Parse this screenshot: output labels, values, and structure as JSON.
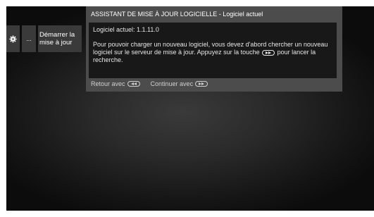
{
  "sidebar": {
    "gear_icon": "gear-icon",
    "dots_label": "...",
    "start_label": "Démarrer la\nmise à jour"
  },
  "dialog": {
    "title": "ASSISTANT DE MISE À JOUR LOGICIELLE - Logiciel actuel",
    "version_line": "Logiciel actuel:  1.1.11.0",
    "description_part1": "Pour pouvoir charger un nouveau logiciel, vous devez d'abord chercher un nouveau logiciel sur le serveur de mise à jour. Appuyez sur la touche",
    "description_icon": "fast-forward-button-icon",
    "description_part2": "pour lancer la recherche.",
    "footer": {
      "back_label": "Retour avec",
      "back_icon": "rewind-button-icon",
      "continue_label": "Continuer avec",
      "continue_icon": "fast-forward-button-icon"
    }
  },
  "colors": {
    "panel_bg": "#4c4c4c",
    "body_bg": "#181818",
    "sidebar_bg": "#3a3a3a",
    "text": "#e6e6e6"
  }
}
